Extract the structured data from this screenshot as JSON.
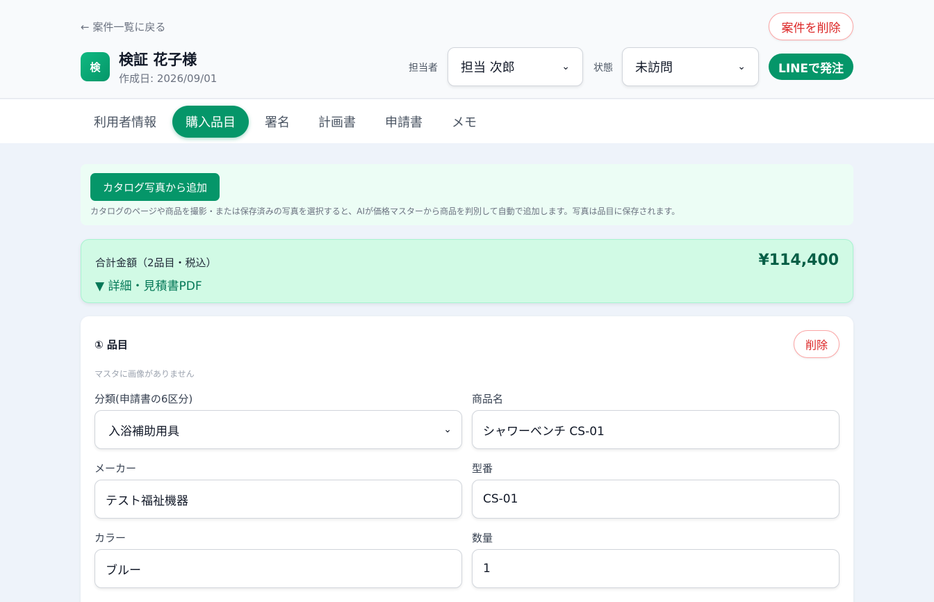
{
  "header": {
    "back_label": "← 案件一覧に戻る",
    "avatar_initial": "検",
    "client_name": "検証 花子様",
    "created_date": "作成日: 2026/09/01",
    "delete_case_label": "案件を削除",
    "assignee_label": "担当者",
    "assignee_value": "担当 次郎",
    "status_label": "状態",
    "status_value": "未訪問",
    "line_order_label": "LINEで発注"
  },
  "tabs": [
    {
      "label": "利用者情報",
      "active": false
    },
    {
      "label": "購入品目",
      "active": true
    },
    {
      "label": "署名",
      "active": false
    },
    {
      "label": "計画書",
      "active": false
    },
    {
      "label": "申請書",
      "active": false
    },
    {
      "label": "メモ",
      "active": false
    }
  ],
  "catalog": {
    "button_label": "カタログ写真から追加",
    "note": "カタログのページや商品を撮影・または保存済みの写真を選択すると、AIが価格マスターから商品を判別して自動で追加します。写真は品目に保存されます。"
  },
  "total": {
    "label": "合計金額（2品目・税込）",
    "amount": "¥114,400",
    "detail_label": "▼ 詳細・見積書PDF"
  },
  "item": {
    "title": "① 品目",
    "delete_label": "削除",
    "no_image": "マスタに画像がありません",
    "category_label": "分類(申請書の6区分)",
    "category_value": "入浴補助用具",
    "product_label": "商品名",
    "product_value": "シャワーベンチ CS-01",
    "maker_label": "メーカー",
    "maker_value": "テスト福祉機器",
    "model_label": "型番",
    "model_value": "CS-01",
    "color_label": "カラー",
    "color_value": "ブルー",
    "qty_label": "数量",
    "qty_value": "1"
  },
  "colors": {
    "accent": "#059669",
    "danger": "#dc2626",
    "total_bg": "#d1fae5"
  }
}
